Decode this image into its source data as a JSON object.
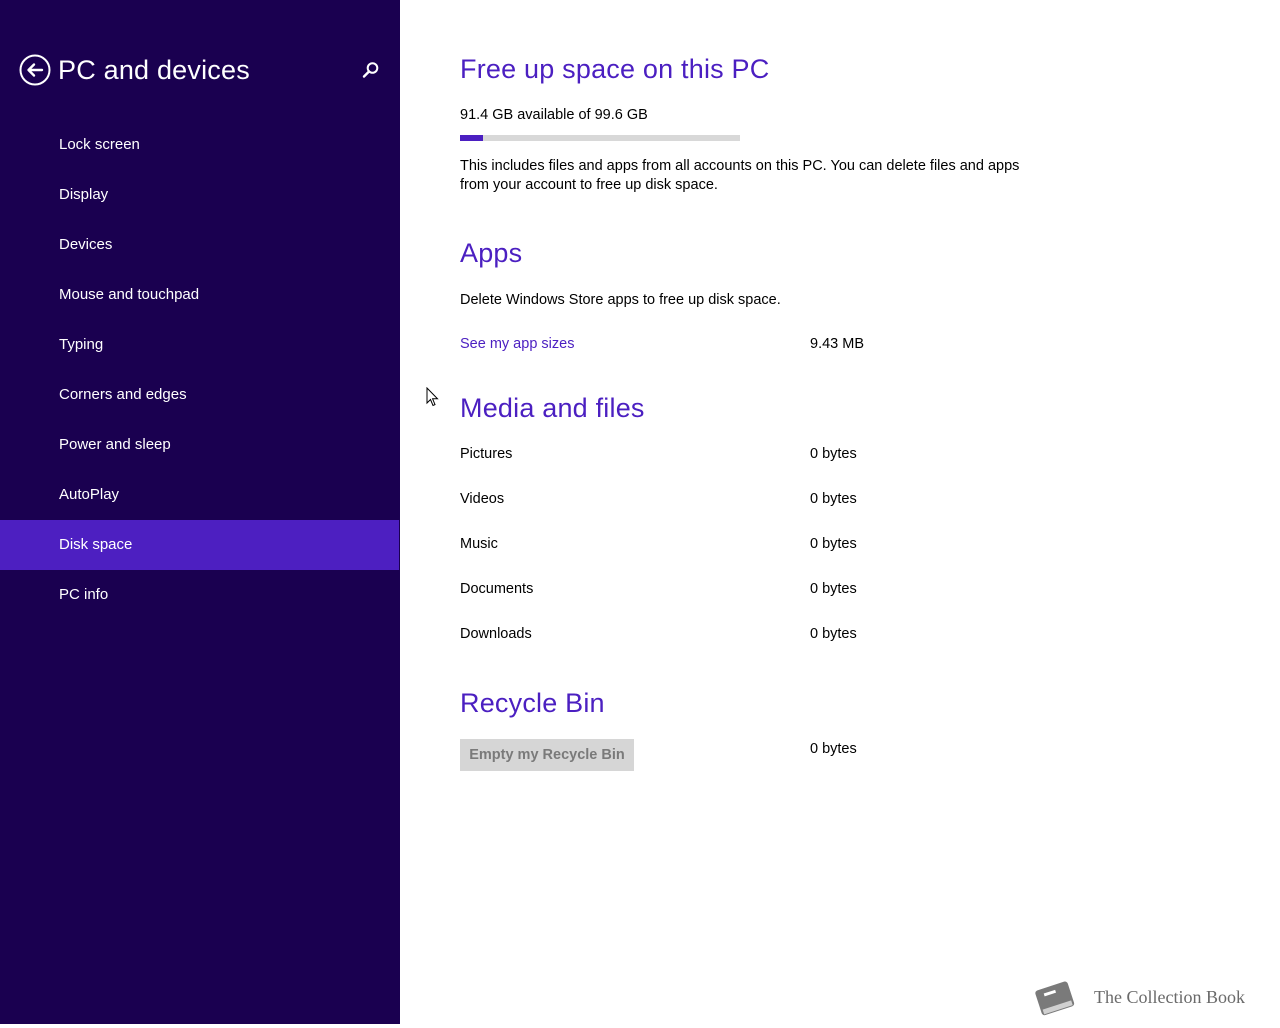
{
  "sidebar": {
    "title": "PC and devices",
    "back_icon": "back-arrow-circle-icon",
    "search_icon": "search-icon",
    "items": [
      {
        "label": "Lock screen"
      },
      {
        "label": "Display"
      },
      {
        "label": "Devices"
      },
      {
        "label": "Mouse and touchpad"
      },
      {
        "label": "Typing"
      },
      {
        "label": "Corners and edges"
      },
      {
        "label": "Power and sleep"
      },
      {
        "label": "AutoPlay"
      },
      {
        "label": "Disk space",
        "selected": true
      },
      {
        "label": "PC info"
      }
    ]
  },
  "main": {
    "title": "Free up space on this PC",
    "availability": "91.4 GB available of 99.6 GB",
    "used_fraction": 0.082,
    "description": "This includes files and apps from all accounts on this PC. You can delete files and apps from your account to free up disk space.",
    "apps": {
      "heading": "Apps",
      "description": "Delete Windows Store apps to free up disk space.",
      "link_label": "See my app sizes",
      "size": "9.43 MB"
    },
    "media": {
      "heading": "Media and files",
      "rows": [
        {
          "label": "Pictures",
          "value": "0 bytes"
        },
        {
          "label": "Videos",
          "value": "0 bytes"
        },
        {
          "label": "Music",
          "value": "0 bytes"
        },
        {
          "label": "Documents",
          "value": "0 bytes"
        },
        {
          "label": "Downloads",
          "value": "0 bytes"
        }
      ]
    },
    "recycle": {
      "heading": "Recycle Bin",
      "button_label": "Empty my Recycle Bin",
      "button_enabled": false,
      "size": "0 bytes"
    }
  },
  "watermark": {
    "text": "The Collection Book",
    "icon": "book-icon"
  },
  "colors": {
    "sidebar_bg": "#1a0050",
    "accent": "#4b1fc1",
    "selected_bg": "#4d1fc1"
  }
}
